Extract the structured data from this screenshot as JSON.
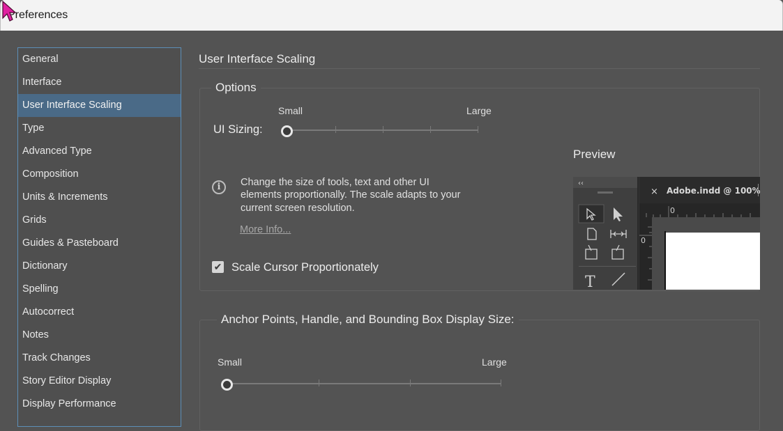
{
  "window": {
    "title": "Preferences"
  },
  "sidebar": {
    "items": [
      {
        "label": "General"
      },
      {
        "label": "Interface"
      },
      {
        "label": "User Interface Scaling"
      },
      {
        "label": "Type"
      },
      {
        "label": "Advanced Type"
      },
      {
        "label": "Composition"
      },
      {
        "label": "Units & Increments"
      },
      {
        "label": "Grids"
      },
      {
        "label": "Guides & Pasteboard"
      },
      {
        "label": "Dictionary"
      },
      {
        "label": "Spelling"
      },
      {
        "label": "Autocorrect"
      },
      {
        "label": "Notes"
      },
      {
        "label": "Track Changes"
      },
      {
        "label": "Story Editor Display"
      },
      {
        "label": "Display Performance"
      }
    ],
    "selected_index": 2
  },
  "main": {
    "heading": "User Interface Scaling",
    "options": {
      "legend": "Options",
      "ui_sizing_label": "UI Sizing:",
      "small_label": "Small",
      "large_label": "Large",
      "ui_sizing_value": 0,
      "info_text": "Change the size of tools, text and other UI elements proportionally. The scale adapts to your current screen resolution.",
      "more_info": "More Info...",
      "scale_cursor_label": "Scale Cursor Proportionately",
      "scale_cursor_checked": true
    },
    "preview": {
      "title": "Preview",
      "collapse_glyph": "‹‹",
      "tab_close": "×",
      "tab_title": "Adobe.indd @ 100%",
      "ruler_h_zero": "0",
      "ruler_v_zero": "0"
    },
    "anchor": {
      "legend": "Anchor Points, Handle, and Bounding Box Display Size:",
      "small_label": "Small",
      "large_label": "Large",
      "value": 0
    }
  },
  "colors": {
    "background": "#535353",
    "selection": "#4a6a87",
    "sidebar_border": "#5d8fb8",
    "cursor_accent": "#e020a0"
  }
}
